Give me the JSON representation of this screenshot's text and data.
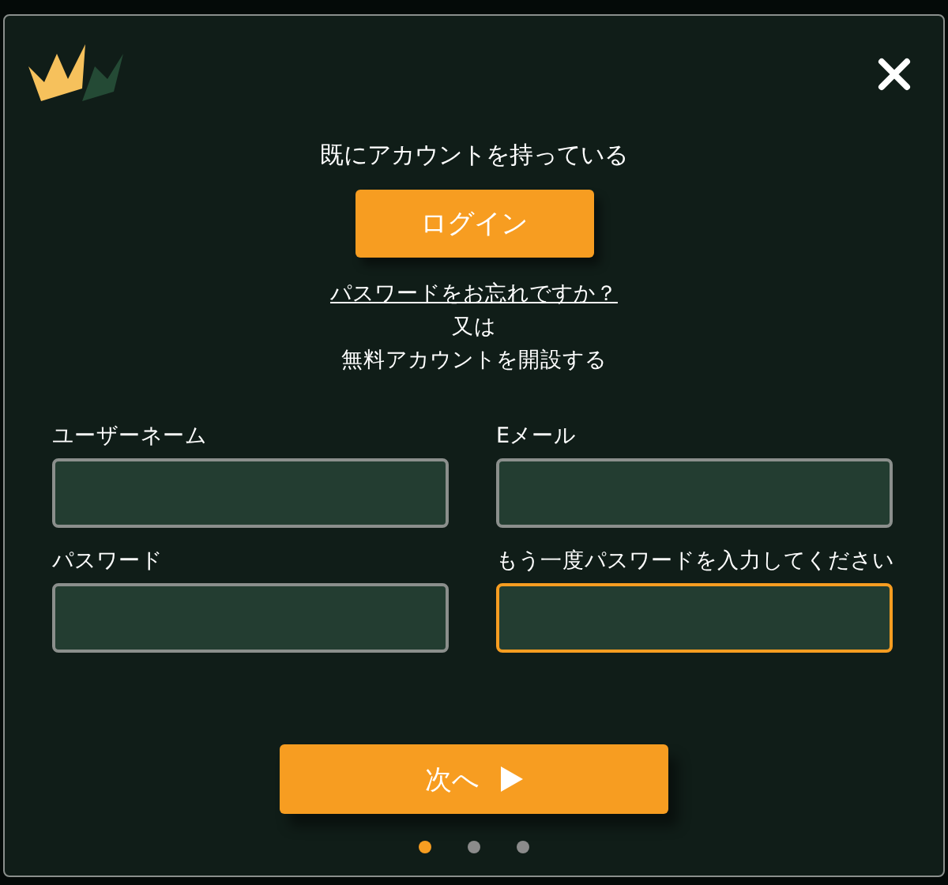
{
  "dialog": {
    "heading": "既にアカウントを持っている",
    "login_button": "ログイン",
    "forgot_link": "パスワードをお忘れですか？",
    "or_text": "又は",
    "signup_text": "無料アカウントを開設する",
    "fields": [
      {
        "label": "ユーザーネーム",
        "focused": false
      },
      {
        "label": "Eメール",
        "focused": false
      },
      {
        "label": "パスワード",
        "focused": false
      },
      {
        "label": "もう一度パスワードを入力してください",
        "focused": true
      }
    ],
    "next_button": "次へ",
    "steps": [
      {
        "selected": true
      },
      {
        "selected": false
      },
      {
        "selected": false
      }
    ]
  }
}
